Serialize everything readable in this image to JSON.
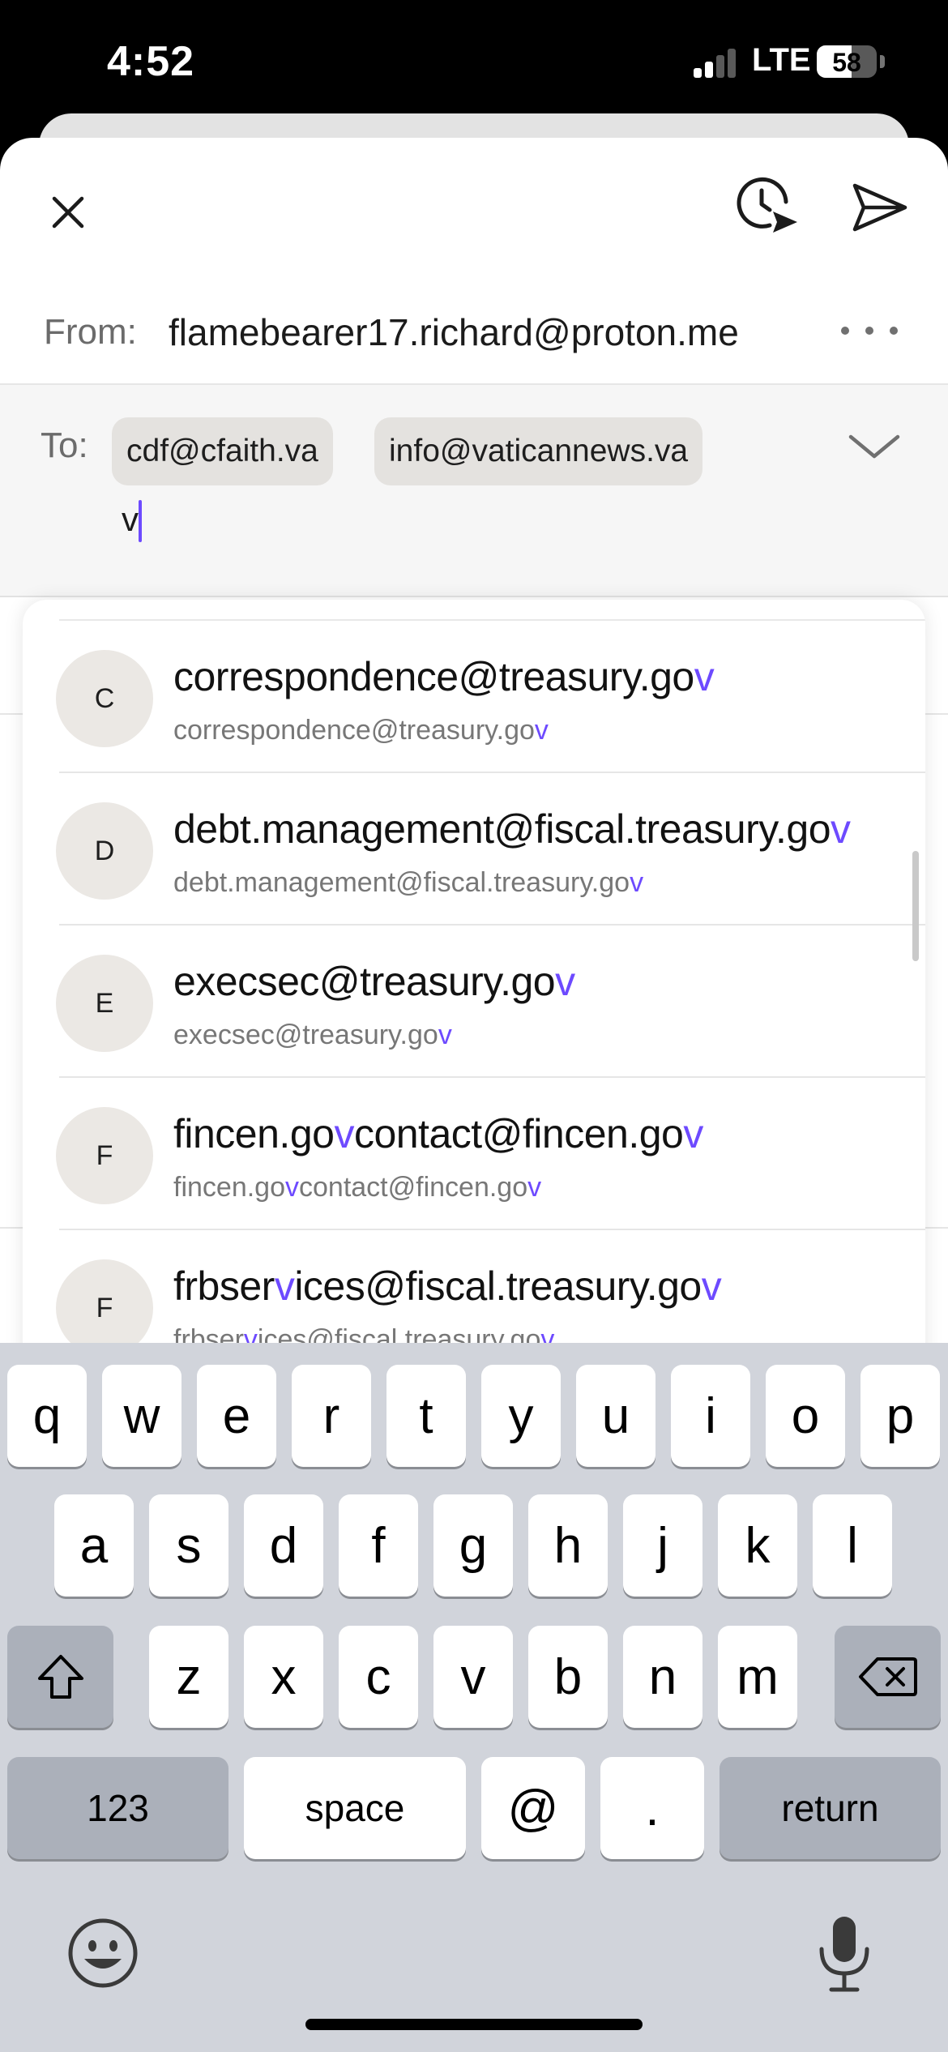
{
  "status_bar": {
    "time": "4:52",
    "network": "LTE",
    "battery_percent": "58",
    "battery_level": 0.58
  },
  "toolbar": {
    "close_icon": "close-icon",
    "schedule_icon": "schedule-send-icon",
    "send_icon": "send-icon"
  },
  "from": {
    "label": "From:",
    "address": "flamebearer17.richard@proton.me"
  },
  "to": {
    "label": "To:",
    "recipients": [
      "cdf@cfaith.va",
      "info@vaticannews.va"
    ],
    "typed_text": "v"
  },
  "suggestions": [
    {
      "initial": "C",
      "name": [
        "correspondence@treasury.go",
        "v",
        ""
      ],
      "email": [
        "correspondence@treasury.go",
        "v",
        ""
      ]
    },
    {
      "initial": "D",
      "name": [
        "debt.management@fiscal.treasury.go",
        "v",
        ""
      ],
      "email": [
        "debt.management@fiscal.treasury.go",
        "v",
        ""
      ]
    },
    {
      "initial": "E",
      "name": [
        "execsec@treasury.go",
        "v",
        ""
      ],
      "email": [
        "execsec@treasury.go",
        "v",
        ""
      ]
    },
    {
      "initial": "F",
      "name": [
        "fincen.go",
        "v",
        "contact@fincen.go",
        "v",
        ""
      ],
      "email": [
        "fincen.go",
        "v",
        "contact@fincen.go",
        "v",
        ""
      ]
    },
    {
      "initial": "F",
      "name": [
        "frbser",
        "v",
        "ices@fiscal.treasury.go",
        "v",
        ""
      ],
      "email": [
        "frbser",
        "v",
        "ices@fiscal.treasury.go",
        "v",
        ""
      ]
    }
  ],
  "colors": {
    "accent": "#6d4aff",
    "keyboard_bg": "#d1d4db"
  },
  "keyboard": {
    "row1": [
      "q",
      "w",
      "e",
      "r",
      "t",
      "y",
      "u",
      "i",
      "o",
      "p"
    ],
    "row2": [
      "a",
      "s",
      "d",
      "f",
      "g",
      "h",
      "j",
      "k",
      "l"
    ],
    "row3": [
      "z",
      "x",
      "c",
      "v",
      "b",
      "n",
      "m"
    ],
    "numbers_label": "123",
    "space_label": "space",
    "at_label": "@",
    "dot_label": ".",
    "return_label": "return",
    "shift_icon": "shift-icon",
    "delete_icon": "backspace-icon",
    "emoji_icon": "emoji-icon",
    "mic_icon": "microphone-icon"
  }
}
